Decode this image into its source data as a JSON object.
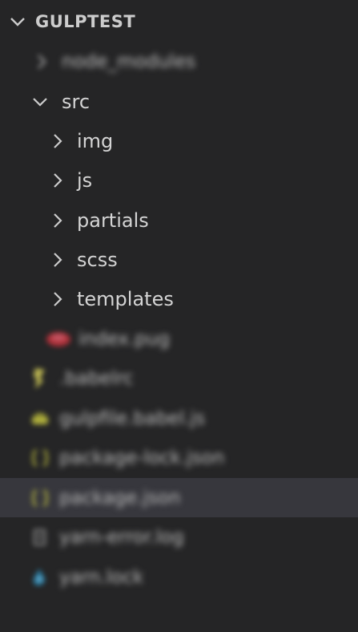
{
  "explorer": {
    "root_folder": "GULPTEST",
    "items": [
      {
        "label": "node_modules",
        "kind": "folder",
        "expanded": false,
        "blurred": true
      },
      {
        "label": "src",
        "kind": "folder",
        "expanded": true,
        "blurred": false
      },
      {
        "label": "img",
        "kind": "folder",
        "expanded": false,
        "blurred": false
      },
      {
        "label": "js",
        "kind": "folder",
        "expanded": false,
        "blurred": false
      },
      {
        "label": "partials",
        "kind": "folder",
        "expanded": false,
        "blurred": false
      },
      {
        "label": "scss",
        "kind": "folder",
        "expanded": false,
        "blurred": false
      },
      {
        "label": "templates",
        "kind": "folder",
        "expanded": false,
        "blurred": false
      },
      {
        "label": "index.pug",
        "kind": "file",
        "icon": "pug-icon",
        "blurred": true
      },
      {
        "label": ".babelrc",
        "kind": "file",
        "icon": "babel-icon",
        "blurred": true
      },
      {
        "label": "gulpfile.babel.js",
        "kind": "file",
        "icon": "js-file-icon",
        "blurred": true
      },
      {
        "label": "package-lock.json",
        "kind": "file",
        "icon": "json-icon",
        "blurred": true
      },
      {
        "label": "package.json",
        "kind": "file",
        "icon": "json-icon",
        "blurred": true,
        "selected": true
      },
      {
        "label": "yarn-error.log",
        "kind": "file",
        "icon": "log-icon",
        "blurred": true
      },
      {
        "label": "yarn.lock",
        "kind": "file",
        "icon": "yarn-icon",
        "blurred": true
      }
    ]
  },
  "colors": {
    "background": "#252526",
    "selected_row": "#37373d",
    "text": "#d4d4d4",
    "pug_red": "#c8323c",
    "babel_yellow": "#d8d15a",
    "json_yellow": "#cbcb41",
    "yarn_blue": "#2c8ebb"
  }
}
